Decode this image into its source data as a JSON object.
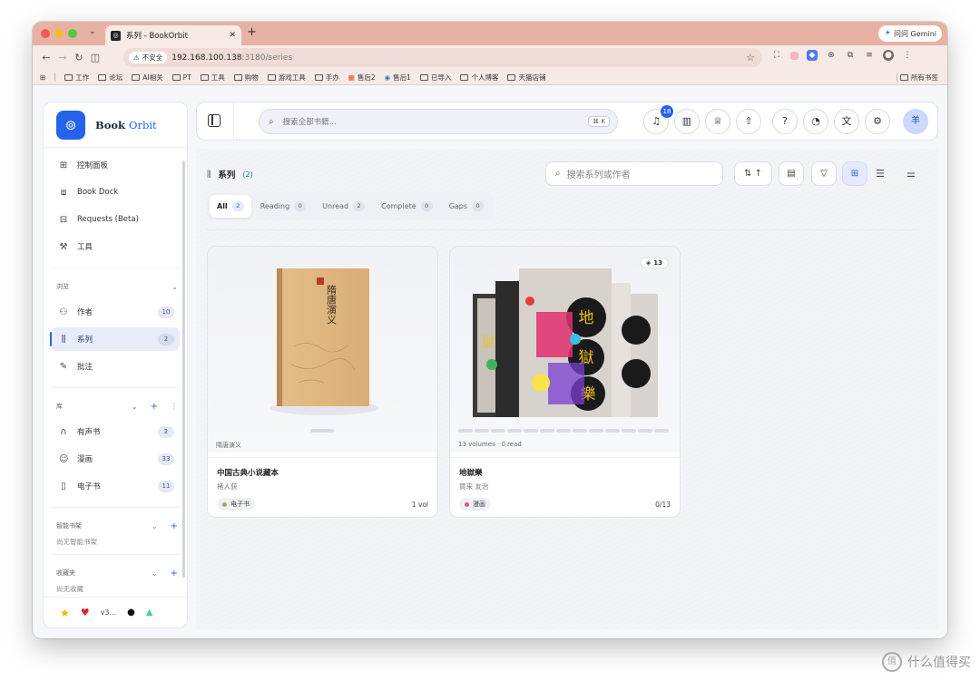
{
  "browser": {
    "tab_title": "系列 - BookOrbit",
    "insecure_label": "不安全",
    "url_host": "192.168.100.138",
    "url_path": ":3180/series",
    "gemini_label": "问问 Gemini",
    "bookmarks": [
      "工作",
      "论坛",
      "AI相关",
      "PT",
      "工具",
      "购物",
      "游戏工具",
      "手办",
      "售后2",
      "售后1",
      "已导入",
      "个人博客",
      "天猫店铺"
    ],
    "all_bookmarks": "所有书签"
  },
  "brand": {
    "name_a": "Book",
    "name_b": "Orbit"
  },
  "sidebar": {
    "top_items": [
      {
        "label": "控制面板"
      },
      {
        "label": "Book Dock"
      },
      {
        "label": "Requests (Beta)"
      },
      {
        "label": "工具"
      }
    ],
    "browse_title": "浏览",
    "browse_items": [
      {
        "label": "作者",
        "count": "10"
      },
      {
        "label": "系列",
        "count": "2"
      },
      {
        "label": "批注"
      }
    ],
    "library_title": "库",
    "library_items": [
      {
        "label": "有声书",
        "count": "2"
      },
      {
        "label": "漫画",
        "count": "33"
      },
      {
        "label": "电子书",
        "count": "11"
      }
    ],
    "smart_title": "智能书架",
    "smart_empty": "尚无智能书架",
    "fav_title": "收藏夹",
    "fav_empty": "尚无收藏",
    "version": "v3..."
  },
  "topbar": {
    "search_placeholder": "搜索全部书籍...",
    "search_shortcut": "⌘ K",
    "notif_count": "18",
    "avatar_text": "羊"
  },
  "content": {
    "title": "系列",
    "count": "(2)",
    "search_placeholder": "搜索系列或作者",
    "tabs": [
      {
        "label": "All",
        "count": "2"
      },
      {
        "label": "Reading",
        "count": "0"
      },
      {
        "label": "Unread",
        "count": "2"
      },
      {
        "label": "Complete",
        "count": "0"
      },
      {
        "label": "Gaps",
        "count": "0"
      }
    ]
  },
  "cards": [
    {
      "cover_caption": "隋唐演义",
      "cover_text": "隋唐演义",
      "title": "中国古典小说藏本",
      "author": "褚人获",
      "tag": "电子书",
      "tag_color": "#8fb64a",
      "meta": "1 vol"
    },
    {
      "cover_caption": "13 volumes · 0 read",
      "stack_count": "13",
      "cover_text": "地獄樂",
      "title": "地獄樂",
      "author": "賀来 友治",
      "tag": "漫画",
      "tag_color": "#e05577",
      "meta": "0/13"
    }
  ],
  "watermark": "什么值得买",
  "colors": {
    "accent": "#2563eb",
    "tab_bar": "#e7b2a4"
  }
}
